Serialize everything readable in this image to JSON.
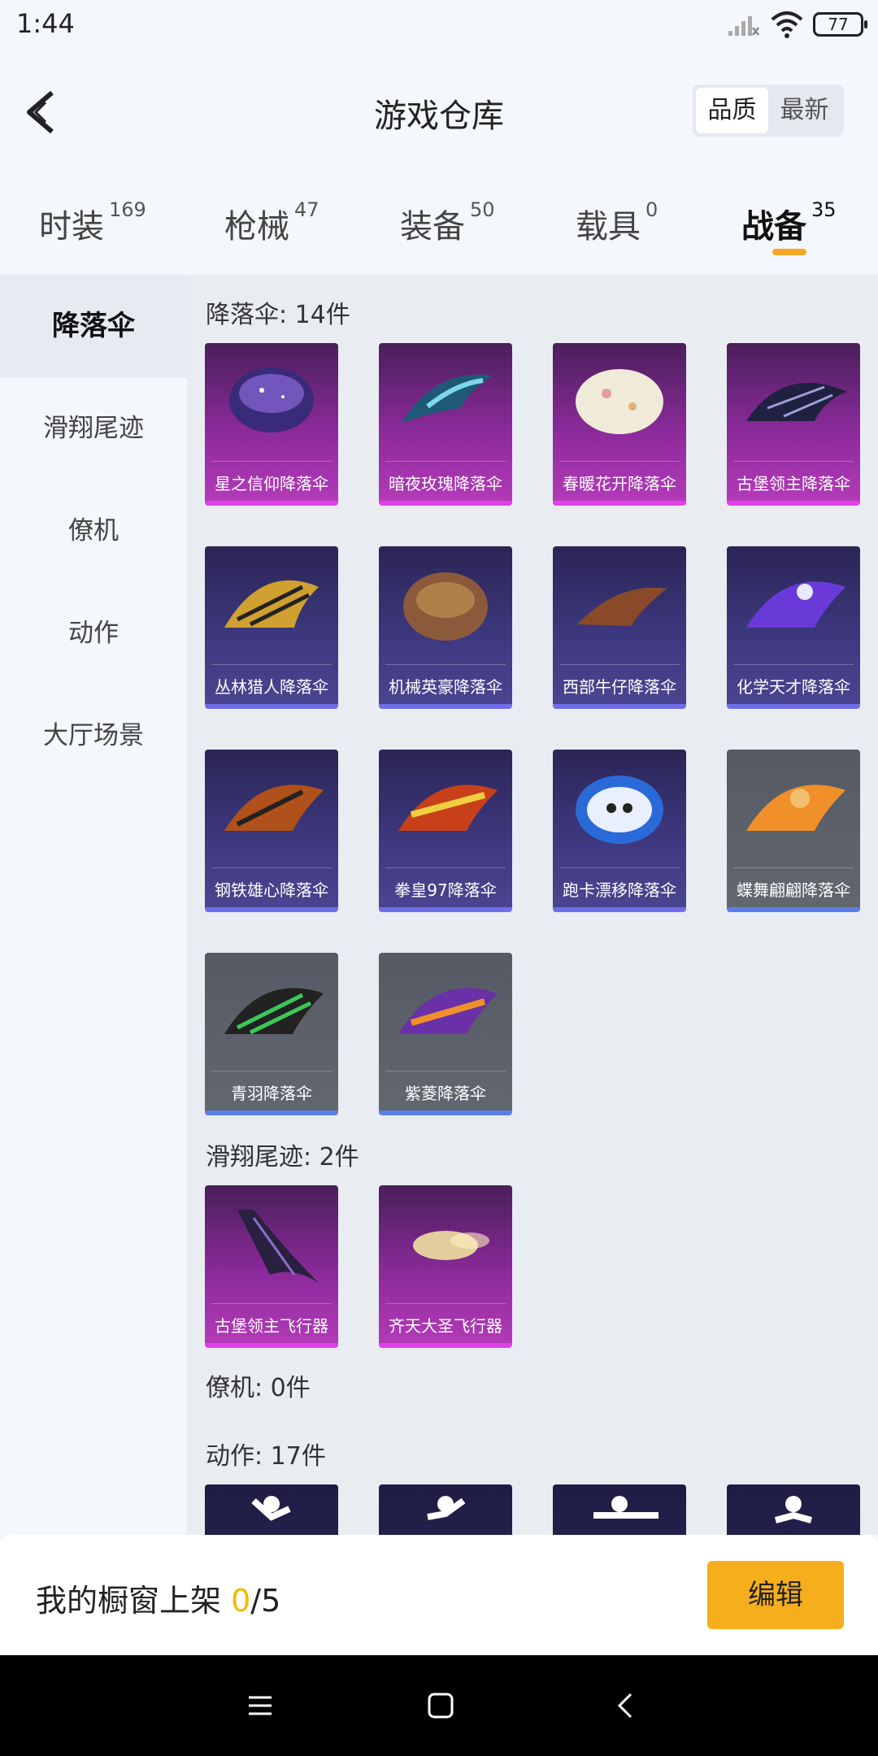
{
  "status": {
    "time": "1:44",
    "battery": "77"
  },
  "header": {
    "title": "游戏仓库",
    "sort": [
      "品质",
      "最新"
    ]
  },
  "tabs": [
    {
      "label": "时装",
      "count": "169"
    },
    {
      "label": "枪械",
      "count": "47"
    },
    {
      "label": "装备",
      "count": "50"
    },
    {
      "label": "载具",
      "count": "0"
    },
    {
      "label": "战备",
      "count": "35"
    }
  ],
  "sidebar": [
    "降落伞",
    "滑翔尾迹",
    "僚机",
    "动作",
    "大厅场景"
  ],
  "sections": {
    "parachute": {
      "title": "降落伞: 14件",
      "items": [
        "星之信仰降落伞",
        "暗夜玫瑰降落伞",
        "春暖花开降落伞",
        "古堡领主降落伞",
        "丛林猎人降落伞",
        "机械英豪降落伞",
        "西部牛仔降落伞",
        "化学天才降落伞",
        "钢铁雄心降落伞",
        "拳皇97降落伞",
        "跑卡漂移降落伞",
        "蝶舞翩翩降落伞",
        "青羽降落伞",
        "紫菱降落伞"
      ]
    },
    "trail": {
      "title": "滑翔尾迹: 2件",
      "items": [
        "古堡领主飞行器",
        "齐天大圣飞行器"
      ]
    },
    "wingman": {
      "title": "僚机: 0件"
    },
    "emote": {
      "title": "动作: 17件"
    }
  },
  "bottom": {
    "prefix": "我的橱窗上架 ",
    "current": "0",
    "total": "/5",
    "edit": "编辑"
  },
  "colors": {
    "accent": "#f5a623",
    "edit_button": "#f6ae1c",
    "pink_rarity": "#e040e8",
    "purple_rarity": "#6f6ee8"
  }
}
